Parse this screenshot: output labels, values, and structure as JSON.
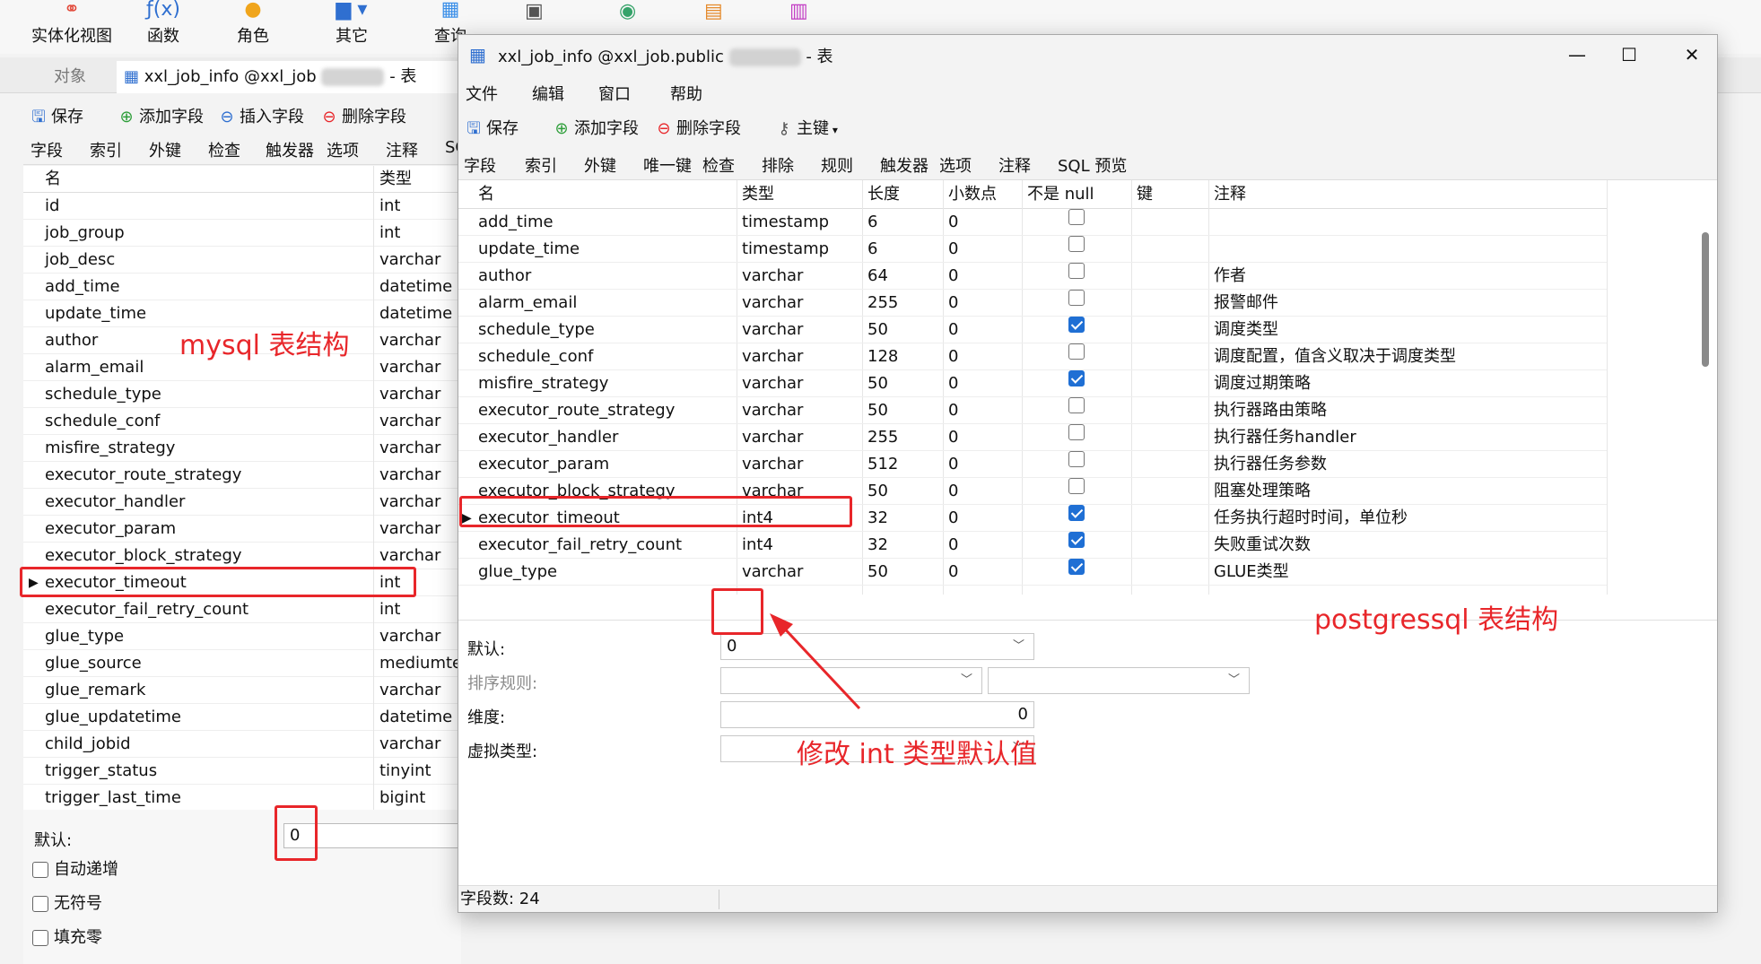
{
  "mysql": {
    "ribbon": [
      {
        "label": "实体化视图",
        "icon": "materialized-view-icon"
      },
      {
        "label": "函数",
        "icon": "function-icon"
      },
      {
        "label": "角色",
        "icon": "role-icon"
      },
      {
        "label": "其它",
        "icon": "other-icon"
      },
      {
        "label": "查询",
        "icon": "query-icon"
      }
    ],
    "tab_object": "对象",
    "tab_table_prefix": "xxl_job_info @xxl_job",
    "tab_table_suffix": "- 表",
    "toolbar": {
      "save": "保存",
      "add_field": "添加字段",
      "insert_field": "插入字段",
      "delete_field": "删除字段"
    },
    "subtabs": [
      "字段",
      "索引",
      "外键",
      "检查",
      "触发器",
      "选项",
      "注释",
      "SQ"
    ],
    "columns": {
      "name": "名",
      "type": "类型"
    },
    "rows": [
      {
        "name": "id",
        "type": "int"
      },
      {
        "name": "job_group",
        "type": "int"
      },
      {
        "name": "job_desc",
        "type": "varchar"
      },
      {
        "name": "add_time",
        "type": "datetime"
      },
      {
        "name": "update_time",
        "type": "datetime"
      },
      {
        "name": "author",
        "type": "varchar"
      },
      {
        "name": "alarm_email",
        "type": "varchar"
      },
      {
        "name": "schedule_type",
        "type": "varchar"
      },
      {
        "name": "schedule_conf",
        "type": "varchar"
      },
      {
        "name": "misfire_strategy",
        "type": "varchar"
      },
      {
        "name": "executor_route_strategy",
        "type": "varchar"
      },
      {
        "name": "executor_handler",
        "type": "varchar"
      },
      {
        "name": "executor_param",
        "type": "varchar"
      },
      {
        "name": "executor_block_strategy",
        "type": "varchar"
      },
      {
        "name": "executor_timeout",
        "type": "int"
      },
      {
        "name": "executor_fail_retry_count",
        "type": "int"
      },
      {
        "name": "glue_type",
        "type": "varchar"
      },
      {
        "name": "glue_source",
        "type": "mediumtex"
      },
      {
        "name": "glue_remark",
        "type": "varchar"
      },
      {
        "name": "glue_updatetime",
        "type": "datetime"
      },
      {
        "name": "child_jobid",
        "type": "varchar"
      },
      {
        "name": "trigger_status",
        "type": "tinyint"
      },
      {
        "name": "trigger_last_time",
        "type": "bigint"
      }
    ],
    "selected_row": 14,
    "default_label": "默认:",
    "default_value": "0",
    "checkboxes": [
      "自动递增",
      "无符号",
      "填充零"
    ]
  },
  "pg": {
    "title_prefix": "xxl_job_info @xxl_job.public",
    "title_suffix": "- 表",
    "menu": [
      "文件",
      "编辑",
      "窗口",
      "帮助"
    ],
    "toolbar": {
      "save": "保存",
      "add_field": "添加字段",
      "delete_field": "删除字段",
      "primary_key": "主键"
    },
    "subtabs": [
      "字段",
      "索引",
      "外键",
      "唯一键",
      "检查",
      "排除",
      "规则",
      "触发器",
      "选项",
      "注释",
      "SQL 预览"
    ],
    "columns": {
      "name": "名",
      "type": "类型",
      "length": "长度",
      "decimals": "小数点",
      "not_null": "不是 null",
      "key": "键",
      "comment": "注释"
    },
    "rows": [
      {
        "name": "add_time",
        "type": "timestamp",
        "length": "6",
        "decimals": "0",
        "not_null": false,
        "comment": ""
      },
      {
        "name": "update_time",
        "type": "timestamp",
        "length": "6",
        "decimals": "0",
        "not_null": false,
        "comment": ""
      },
      {
        "name": "author",
        "type": "varchar",
        "length": "64",
        "decimals": "0",
        "not_null": false,
        "comment": "作者"
      },
      {
        "name": "alarm_email",
        "type": "varchar",
        "length": "255",
        "decimals": "0",
        "not_null": false,
        "comment": "报警邮件"
      },
      {
        "name": "schedule_type",
        "type": "varchar",
        "length": "50",
        "decimals": "0",
        "not_null": true,
        "comment": "调度类型"
      },
      {
        "name": "schedule_conf",
        "type": "varchar",
        "length": "128",
        "decimals": "0",
        "not_null": false,
        "comment": "调度配置，值含义取决于调度类型"
      },
      {
        "name": "misfire_strategy",
        "type": "varchar",
        "length": "50",
        "decimals": "0",
        "not_null": true,
        "comment": "调度过期策略"
      },
      {
        "name": "executor_route_strategy",
        "type": "varchar",
        "length": "50",
        "decimals": "0",
        "not_null": false,
        "comment": "执行器路由策略"
      },
      {
        "name": "executor_handler",
        "type": "varchar",
        "length": "255",
        "decimals": "0",
        "not_null": false,
        "comment": "执行器任务handler"
      },
      {
        "name": "executor_param",
        "type": "varchar",
        "length": "512",
        "decimals": "0",
        "not_null": false,
        "comment": "执行器任务参数"
      },
      {
        "name": "executor_block_strategy",
        "type": "varchar",
        "length": "50",
        "decimals": "0",
        "not_null": false,
        "comment": "阻塞处理策略"
      },
      {
        "name": "executor_timeout",
        "type": "int4",
        "length": "32",
        "decimals": "0",
        "not_null": true,
        "comment": "任务执行超时时间，单位秒"
      },
      {
        "name": "executor_fail_retry_count",
        "type": "int4",
        "length": "32",
        "decimals": "0",
        "not_null": true,
        "comment": "失败重试次数"
      },
      {
        "name": "glue_type",
        "type": "varchar",
        "length": "50",
        "decimals": "0",
        "not_null": true,
        "comment": "GLUE类型"
      }
    ],
    "selected_row": 11,
    "props": {
      "default_label": "默认:",
      "default_value": "0",
      "collation_label": "排序规则:",
      "dimension_label": "维度:",
      "dimension_value": "0",
      "virtual_type_label": "虚拟类型:"
    },
    "status": "字段数: 24"
  },
  "annotations": {
    "mysql": "mysql 表结构",
    "pg": "postgressql 表结构",
    "modify": "修改 int 类型默认值"
  },
  "colors": {
    "annotation": "#e8262a",
    "checkbox_on": "#1f6fd4"
  }
}
